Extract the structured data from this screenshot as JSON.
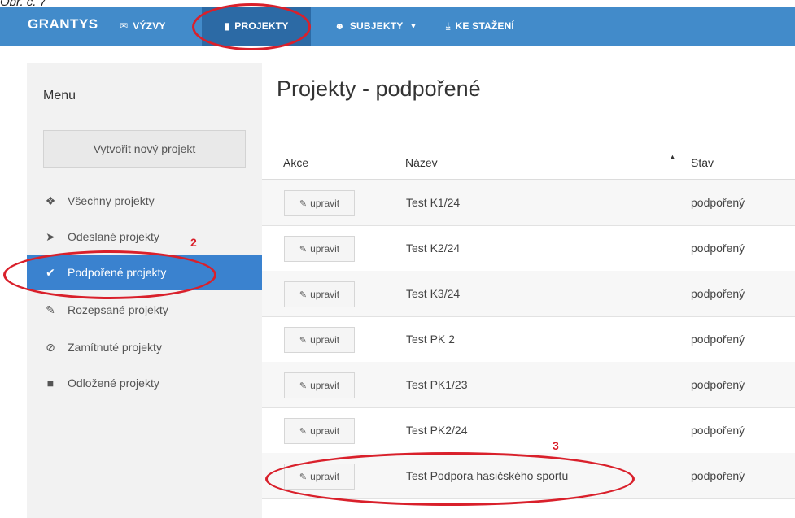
{
  "caption": "Obr. č. 7",
  "navbar": {
    "brand": "GRANTYS",
    "items": [
      {
        "label": "VÝZVY",
        "icon": "megaphone-icon"
      },
      {
        "label": "PROJEKTY",
        "icon": "document-icon"
      },
      {
        "label": "SUBJEKTY",
        "icon": "users-icon"
      },
      {
        "label": "KE STAŽENÍ",
        "icon": "download-icon"
      }
    ],
    "active": "PROJEKTY",
    "colors": {
      "bar": "#428bca",
      "active": "#2c6aa5"
    }
  },
  "sidebar": {
    "title": "Menu",
    "create_label": "Vytvořit nový projekt",
    "items": [
      {
        "label": "Všechny projekty",
        "icon": "cubes-icon"
      },
      {
        "label": "Odeslané projekty",
        "icon": "paper-plane-icon"
      },
      {
        "label": "Podpořené projekty",
        "icon": "check-icon"
      },
      {
        "label": "Rozepsané projekty",
        "icon": "pencil-icon"
      },
      {
        "label": "Zamítnuté projekty",
        "icon": "ban-icon"
      },
      {
        "label": "Odložené projekty",
        "icon": "archive-icon"
      }
    ],
    "active": "Podpořené projekty"
  },
  "main": {
    "title": "Projekty - podpořené",
    "columns": {
      "akce": "Akce",
      "nazev": "Název",
      "stav": "Stav"
    },
    "edit_label": "upravit",
    "rows": [
      {
        "name": "Test K1/24",
        "status": "podpořený"
      },
      {
        "name": "Test K2/24",
        "status": "podpořený"
      },
      {
        "name": "Test K3/24",
        "status": "podpořený"
      },
      {
        "name": "Test PK 2",
        "status": "podpořený"
      },
      {
        "name": "Test PK1/23",
        "status": "podpořený"
      },
      {
        "name": "Test PK2/24",
        "status": "podpořený"
      },
      {
        "name": "Test  Podpora hasičského sportu",
        "status": "podpořený"
      }
    ]
  },
  "annotations": {
    "marker_2": "2",
    "marker_3": "3",
    "color": "#d9202b"
  }
}
